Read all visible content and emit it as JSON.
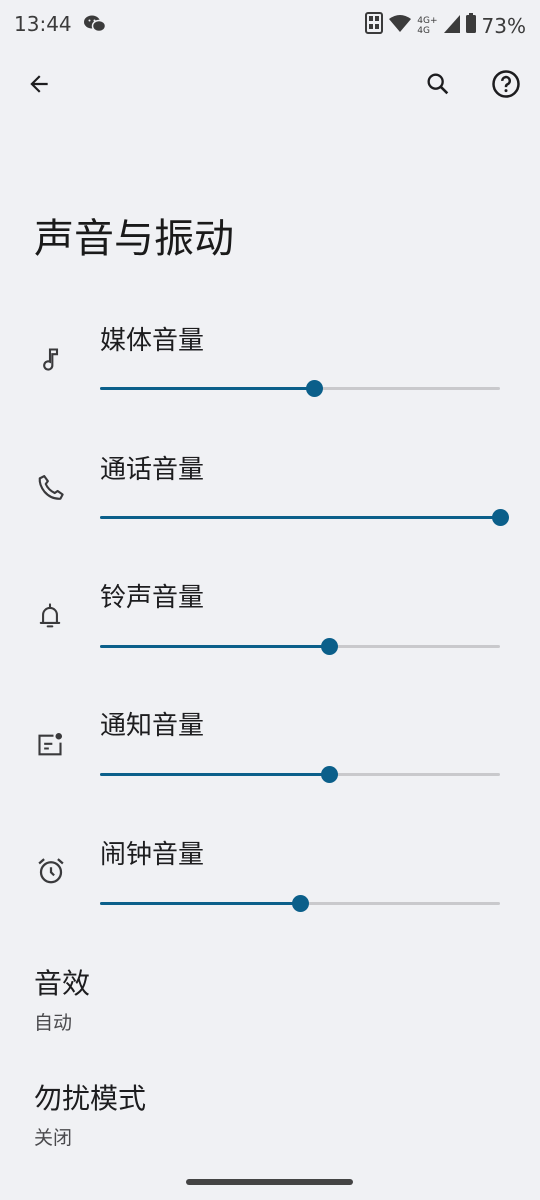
{
  "status": {
    "time": "13:44",
    "net_top": "4G+",
    "net_bottom": "4G",
    "battery": "73%"
  },
  "appbar": {
    "back_icon": "arrow-back-icon",
    "search_icon": "search-icon",
    "help_icon": "help-icon"
  },
  "page": {
    "title": "声音与振动"
  },
  "volumes": [
    {
      "label": "媒体音量",
      "icon": "music-note-icon",
      "level": 0.535
    },
    {
      "label": "通话音量",
      "icon": "phone-icon",
      "level": 1.0
    },
    {
      "label": "铃声音量",
      "icon": "bell-icon",
      "level": 0.573
    },
    {
      "label": "通知音量",
      "icon": "notification-icon",
      "level": 0.573
    },
    {
      "label": "闹钟音量",
      "icon": "alarm-icon",
      "level": 0.5
    }
  ],
  "settings": [
    {
      "title": "音效",
      "subtitle": "自动"
    },
    {
      "title": "勿扰模式",
      "subtitle": "关闭"
    }
  ],
  "accent": "#0b5f8a"
}
